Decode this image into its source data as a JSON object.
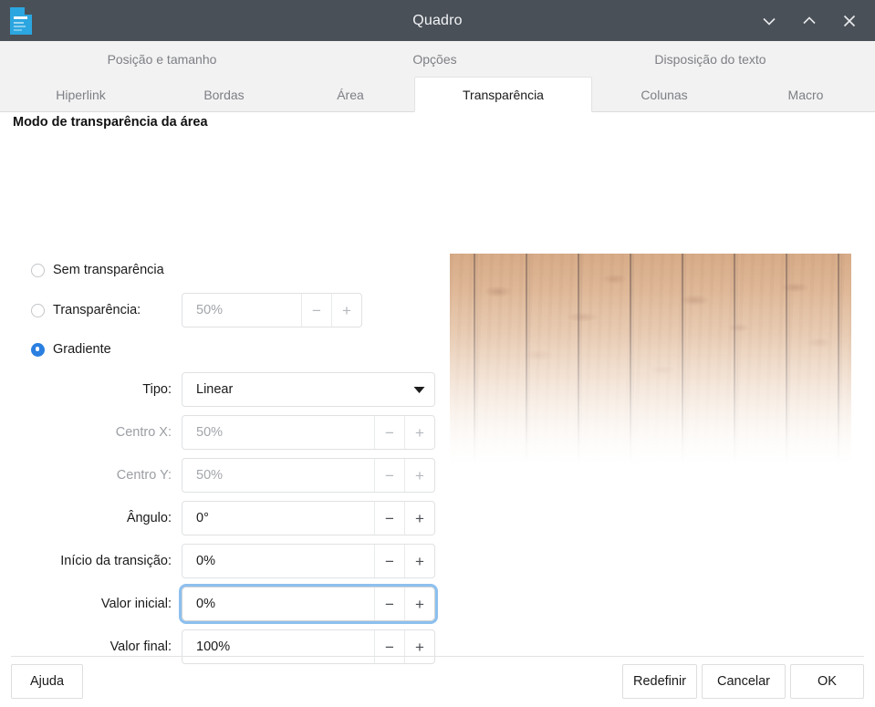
{
  "window": {
    "title": "Quadro",
    "icon": "document-icon",
    "controls": [
      {
        "name": "minimize-button",
        "glyph": "chevron-down-icon"
      },
      {
        "name": "maximize-button",
        "glyph": "chevron-up-icon"
      },
      {
        "name": "close-button",
        "glyph": "close-icon"
      }
    ]
  },
  "tabs": {
    "row1": [
      {
        "label": "Posição e tamanho",
        "active": false
      },
      {
        "label": "Opções",
        "active": false
      },
      {
        "label": "Disposição do texto",
        "active": false
      }
    ],
    "row2": [
      {
        "label": "Hiperlink",
        "active": false
      },
      {
        "label": "Bordas",
        "active": false
      },
      {
        "label": "Área",
        "active": false
      },
      {
        "label": "Transparência",
        "active": true
      },
      {
        "label": "Colunas",
        "active": false
      },
      {
        "label": "Macro",
        "active": false
      }
    ]
  },
  "panel": {
    "section_title": "Modo de transparência da área",
    "radios": [
      {
        "label": "Sem transparência",
        "checked": false
      },
      {
        "label": "Transparência:",
        "checked": false
      },
      {
        "label": "Gradiente",
        "checked": true
      }
    ],
    "transparency_field": {
      "value": "50%",
      "enabled": false,
      "minus": "−",
      "plus": "+"
    },
    "gradient_fields": [
      {
        "label": "Tipo:",
        "value": "Linear",
        "kind": "combo",
        "enabled": true,
        "arrow": "chevron-down-icon"
      },
      {
        "label": "Centro X:",
        "value": "50%",
        "kind": "spin",
        "enabled": false,
        "minus": "−",
        "plus": "+"
      },
      {
        "label": "Centro Y:",
        "value": "50%",
        "kind": "spin",
        "enabled": false,
        "minus": "−",
        "plus": "+"
      },
      {
        "label": "Ângulo:",
        "value": "0°",
        "kind": "spin",
        "enabled": true,
        "minus": "−",
        "plus": "+"
      },
      {
        "label": "Início da transição:",
        "value": "0%",
        "kind": "spin",
        "enabled": true,
        "minus": "−",
        "plus": "+"
      },
      {
        "label": "Valor inicial:",
        "value": "0%",
        "kind": "spin",
        "enabled": true,
        "focused": true,
        "minus": "−",
        "plus": "+"
      },
      {
        "label": "Valor final:",
        "value": "100%",
        "kind": "spin",
        "enabled": true,
        "minus": "−",
        "plus": "+"
      }
    ],
    "preview": {
      "name": "transparency-preview",
      "description": "wood plank texture fading to transparent downward"
    }
  },
  "buttons": {
    "help": "Ajuda",
    "reset": "Redefinir",
    "cancel": "Cancelar",
    "ok": "OK"
  },
  "colors": {
    "titlebar": "#4a5058",
    "accent": "#2a7fe0",
    "focus_ring": "#8dc0ef",
    "tabstrip": "#f2f2f2",
    "tab_inactive_text": "#7d7f85",
    "disabled_text": "#a3a6ab"
  }
}
